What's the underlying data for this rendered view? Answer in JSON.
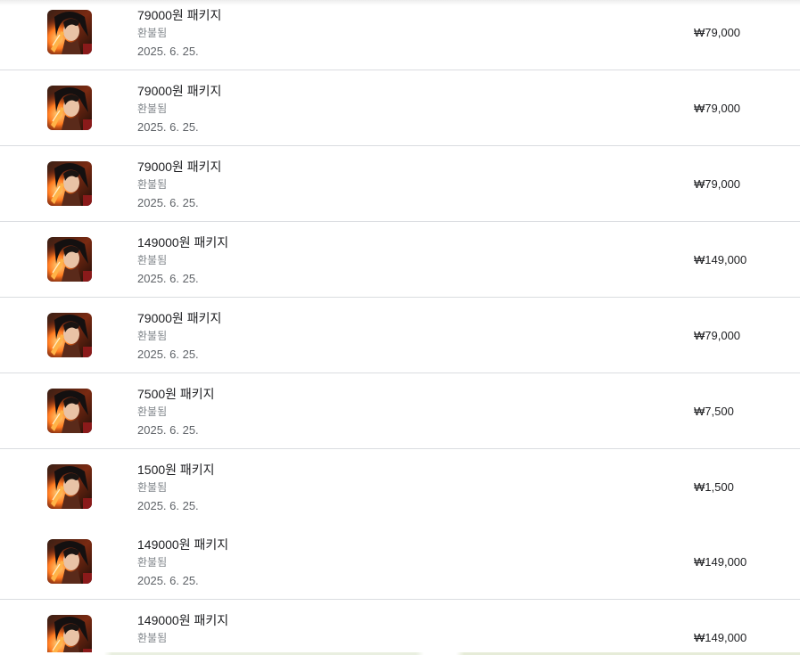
{
  "purchases": [
    {
      "title": "79000원 패키지",
      "status": "환불됨",
      "date": "2025. 6. 25.",
      "price": "₩79,000",
      "icon": "game-character-icon"
    },
    {
      "title": "79000원 패키지",
      "status": "환불됨",
      "date": "2025. 6. 25.",
      "price": "₩79,000",
      "icon": "game-character-icon"
    },
    {
      "title": "79000원 패키지",
      "status": "환불됨",
      "date": "2025. 6. 25.",
      "price": "₩79,000",
      "icon": "game-character-icon"
    },
    {
      "title": "149000원 패키지",
      "status": "환불됨",
      "date": "2025. 6. 25.",
      "price": "₩149,000",
      "icon": "game-character-icon"
    },
    {
      "title": "79000원 패키지",
      "status": "환불됨",
      "date": "2025. 6. 25.",
      "price": "₩79,000",
      "icon": "game-character-icon"
    },
    {
      "title": "7500원 패키지",
      "status": "환불됨",
      "date": "2025. 6. 25.",
      "price": "₩7,500",
      "icon": "game-character-icon"
    },
    {
      "title": "1500원 패키지",
      "status": "환불됨",
      "date": "2025. 6. 25.",
      "price": "₩1,500",
      "icon": "game-character-icon"
    },
    {
      "title": "149000원 패키지",
      "status": "환불됨",
      "date": "2025. 6. 25.",
      "price": "₩149,000",
      "icon": "game-character-icon"
    },
    {
      "title": "149000원 패키지",
      "status": "환불됨",
      "date": "",
      "price": "₩149,000",
      "icon": "game-character-icon"
    }
  ]
}
